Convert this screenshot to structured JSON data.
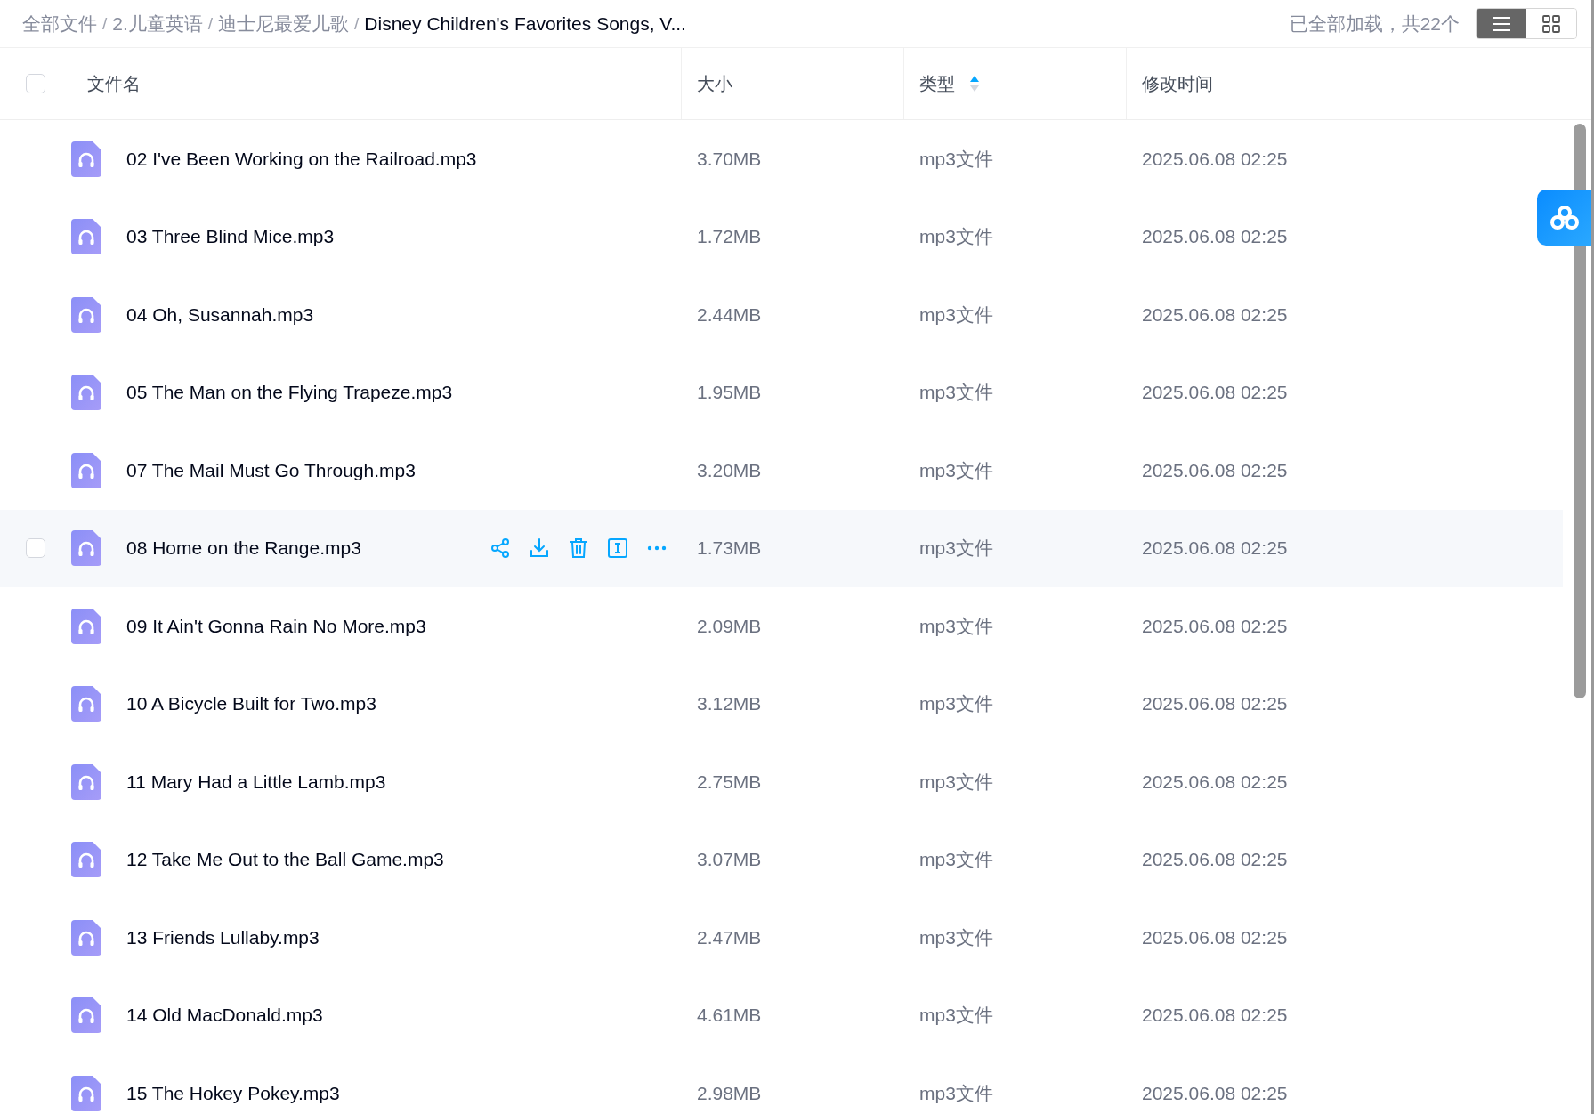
{
  "breadcrumb": [
    {
      "label": "全部文件",
      "current": false
    },
    {
      "separator": "/",
      "label": "2.儿童英语",
      "current": false
    },
    {
      "separator": "/",
      "label": "迪士尼最爱儿歌",
      "current": false
    },
    {
      "separator": "/",
      "label": "Disney Children's Favorites Songs, V...",
      "current": true
    }
  ],
  "load_status": "已全部加载，共22个",
  "view_toggle": [
    {
      "kind": "list",
      "selected": true
    },
    {
      "kind": "grid",
      "selected": false
    }
  ],
  "table": {
    "select_all": {
      "checked": false
    },
    "columns": [
      {
        "label": "文件名",
        "sorted": false
      },
      {
        "label": "大小",
        "sorted": false
      },
      {
        "label": "类型",
        "sorted": true
      },
      {
        "label": "修改时间",
        "sorted": false
      }
    ],
    "rows": [
      {
        "name": "02 I've Been Working on the Railroad.mp3",
        "size": "3.70MB",
        "type": "mp3文件",
        "modified": "2025.06.08 02:25",
        "hovered": false
      },
      {
        "name": "03 Three Blind Mice.mp3",
        "size": "1.72MB",
        "type": "mp3文件",
        "modified": "2025.06.08 02:25",
        "hovered": false
      },
      {
        "name": "04 Oh, Susannah.mp3",
        "size": "2.44MB",
        "type": "mp3文件",
        "modified": "2025.06.08 02:25",
        "hovered": false
      },
      {
        "name": "05 The Man on the Flying Trapeze.mp3",
        "size": "1.95MB",
        "type": "mp3文件",
        "modified": "2025.06.08 02:25",
        "hovered": false
      },
      {
        "name": "07 The Mail Must Go Through.mp3",
        "size": "3.20MB",
        "type": "mp3文件",
        "modified": "2025.06.08 02:25",
        "hovered": false
      },
      {
        "name": "08 Home on the Range.mp3",
        "size": "1.73MB",
        "type": "mp3文件",
        "modified": "2025.06.08 02:25",
        "hovered": true
      },
      {
        "name": "09 It Ain't Gonna Rain No More.mp3",
        "size": "2.09MB",
        "type": "mp3文件",
        "modified": "2025.06.08 02:25",
        "hovered": false
      },
      {
        "name": "10 A Bicycle Built for Two.mp3",
        "size": "3.12MB",
        "type": "mp3文件",
        "modified": "2025.06.08 02:25",
        "hovered": false
      },
      {
        "name": "11 Mary Had a Little Lamb.mp3",
        "size": "2.75MB",
        "type": "mp3文件",
        "modified": "2025.06.08 02:25",
        "hovered": false
      },
      {
        "name": "12 Take Me Out to the Ball Game.mp3",
        "size": "3.07MB",
        "type": "mp3文件",
        "modified": "2025.06.08 02:25",
        "hovered": false
      },
      {
        "name": "13 Friends Lullaby.mp3",
        "size": "2.47MB",
        "type": "mp3文件",
        "modified": "2025.06.08 02:25",
        "hovered": false
      },
      {
        "name": "14 Old MacDonald.mp3",
        "size": "4.61MB",
        "type": "mp3文件",
        "modified": "2025.06.08 02:25",
        "hovered": false
      },
      {
        "name": "15 The Hokey Pokey.mp3",
        "size": "2.98MB",
        "type": "mp3文件",
        "modified": "2025.06.08 02:25",
        "hovered": false
      }
    ]
  }
}
